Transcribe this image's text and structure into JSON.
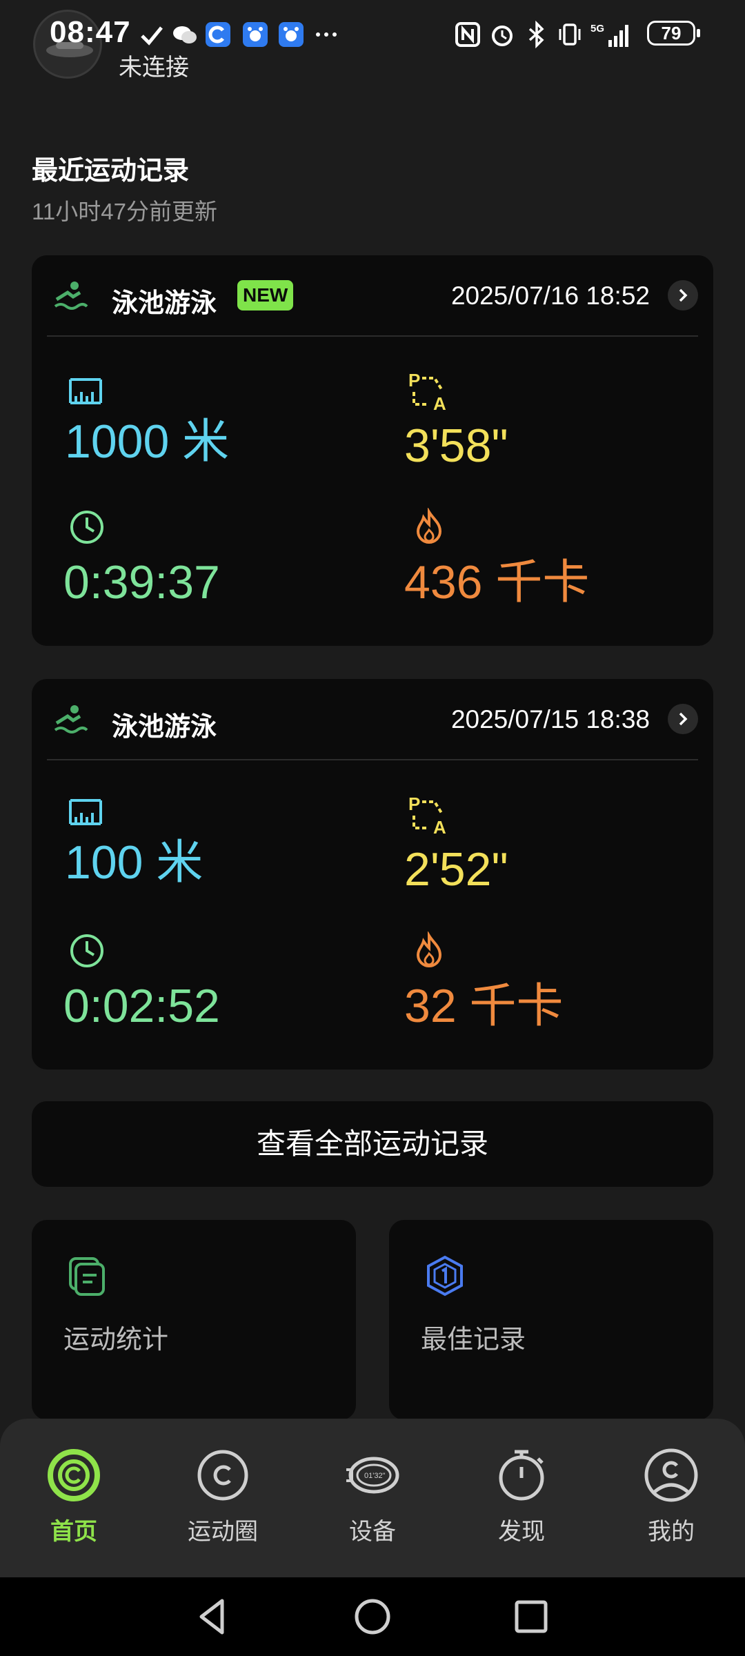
{
  "status": {
    "time": "08:47",
    "battery": "79"
  },
  "header": {
    "connection": "未连接"
  },
  "recent": {
    "title": "最近运动记录",
    "updated": "11小时47分前更新"
  },
  "records": [
    {
      "type": "泳池游泳",
      "badge": "NEW",
      "datetime": "2025/07/16 18:52",
      "distance": "1000 米",
      "pace": "3'58\"",
      "duration": "0:39:37",
      "calories": "436 千卡"
    },
    {
      "type": "泳池游泳",
      "datetime": "2025/07/15 18:38",
      "distance": "100 米",
      "pace": "2'52\"",
      "duration": "0:02:52",
      "calories": "32 千卡"
    }
  ],
  "view_all": "查看全部运动记录",
  "tiles": {
    "stats": "运动统计",
    "best": "最佳记录"
  },
  "tabs": [
    {
      "label": "首页",
      "active": true,
      "icon": "home-ring-icon"
    },
    {
      "label": "运动圈",
      "icon": "circle-c-icon"
    },
    {
      "label": "设备",
      "icon": "watch-icon"
    },
    {
      "label": "发现",
      "icon": "stopwatch-icon"
    },
    {
      "label": "我的",
      "icon": "profile-icon"
    }
  ],
  "colors": {
    "accent": "#8fe34a",
    "distance": "#5fd3ef",
    "pace": "#f3e05a",
    "duration": "#7ee39a",
    "calories": "#f08a3e",
    "best_icon": "#4a7bf0"
  }
}
